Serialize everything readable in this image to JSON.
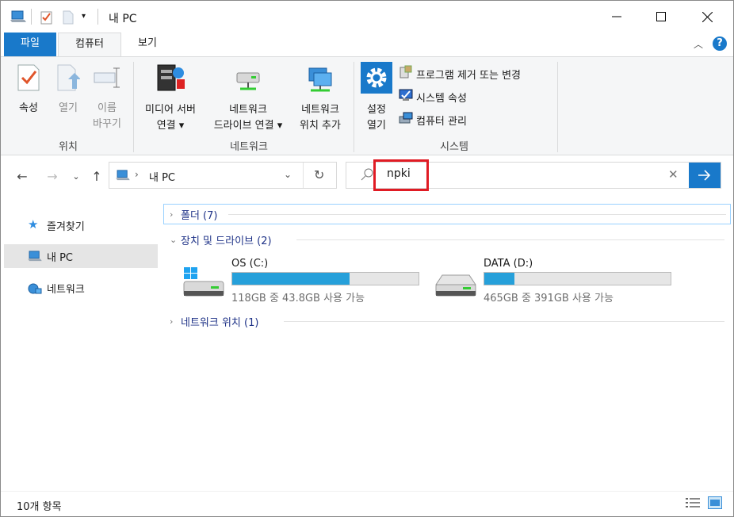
{
  "window": {
    "title": "내 PC"
  },
  "ribbon_tabs": {
    "file": "파일",
    "computer": "컴퓨터",
    "view": "보기"
  },
  "ribbon": {
    "location": {
      "label": "위치",
      "properties": "속성",
      "open": "열기",
      "rename_line1": "이름",
      "rename_line2": "바꾸기"
    },
    "network": {
      "label": "네트워크",
      "media_line1": "미디어 서버",
      "media_line2": "연결",
      "drive_line1": "네트워크",
      "drive_line2": "드라이브 연결",
      "add_loc_line1": "네트워크",
      "add_loc_line2": "위치 추가"
    },
    "system": {
      "label": "시스템",
      "settings_line1": "설정",
      "settings_line2": "열기",
      "uninstall": "프로그램 제거 또는 변경",
      "system_props": "시스템 속성",
      "manage": "컴퓨터 관리"
    }
  },
  "address": {
    "crumb": "내 PC"
  },
  "search": {
    "value": "npki"
  },
  "nav": {
    "quick_access": "즐겨찾기",
    "this_pc": "내 PC",
    "network": "네트워크"
  },
  "content": {
    "folders_group": "폴더 (7)",
    "devices_group": "장치 및 드라이브 (2)",
    "network_group": "네트워크 위치 (1)",
    "drives": [
      {
        "name": "OS (C:)",
        "free_text": "118GB 중 43.8GB 사용 가능",
        "used_fraction": 0.63
      },
      {
        "name": "DATA (D:)",
        "free_text": "465GB 중 391GB 사용 가능",
        "used_fraction": 0.16
      }
    ]
  },
  "status": {
    "item_count": "10개 항목"
  },
  "colors": {
    "accent": "#1979ca",
    "drive_bar": "#26a0da",
    "highlight_box": "#e01b24"
  }
}
